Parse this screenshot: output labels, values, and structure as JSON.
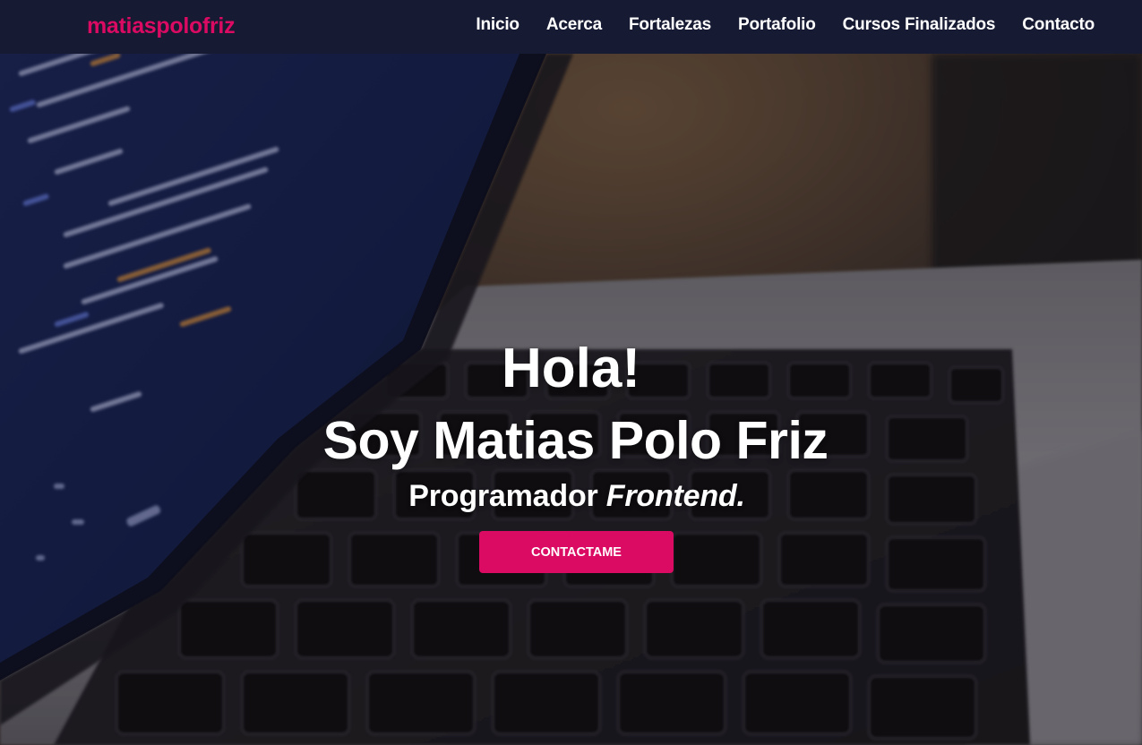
{
  "nav": {
    "brand": "matiaspolofriz",
    "links": [
      {
        "label": "Inicio"
      },
      {
        "label": "Acerca"
      },
      {
        "label": "Fortalezas"
      },
      {
        "label": "Portafolio"
      },
      {
        "label": "Cursos Finalizados"
      },
      {
        "label": "Contacto"
      }
    ]
  },
  "hero": {
    "greeting": "Hola!",
    "name_line": "Soy Matias Polo Friz",
    "role_prefix": "Programador ",
    "role_emphasis": "Frontend.",
    "cta_label": "CONTACTAME"
  },
  "colors": {
    "accent": "#db0a63",
    "navbar_bg": "#161a32",
    "text": "#ffffff"
  }
}
